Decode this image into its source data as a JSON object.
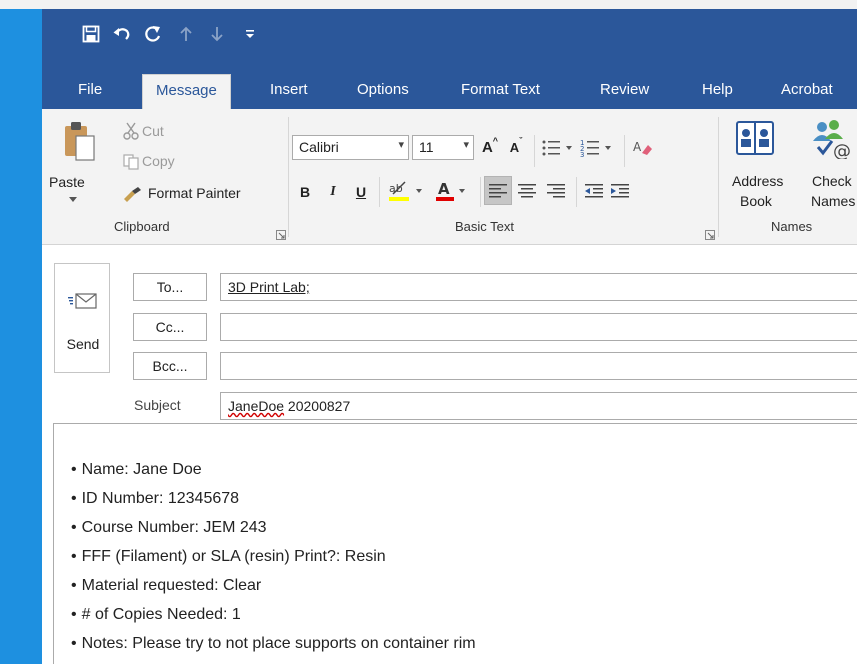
{
  "qat": {
    "icons": [
      "save-icon",
      "undo-icon",
      "redo-icon",
      "previous-item-icon",
      "next-item-icon",
      "customize-qat-icon"
    ]
  },
  "tabs": [
    {
      "label": "File",
      "active": false
    },
    {
      "label": "Message",
      "active": true
    },
    {
      "label": "Insert",
      "active": false
    },
    {
      "label": "Options",
      "active": false
    },
    {
      "label": "Format Text",
      "active": false
    },
    {
      "label": "Review",
      "active": false
    },
    {
      "label": "Help",
      "active": false
    },
    {
      "label": "Acrobat",
      "active": false
    }
  ],
  "ribbon": {
    "clipboard": {
      "label": "Clipboard",
      "paste": "Paste",
      "cut": "Cut",
      "copy": "Copy",
      "format_painter": "Format Painter"
    },
    "basic_text": {
      "label": "Basic Text",
      "font": "Calibri",
      "size": "11",
      "bold": "B",
      "italic": "I",
      "underline": "U"
    },
    "names": {
      "label": "Names",
      "address_book_line1": "Address",
      "address_book_line2": "Book",
      "check_names_line1": "Check",
      "check_names_line2": "Names"
    }
  },
  "compose": {
    "send": "Send",
    "to_button": "To...",
    "cc_button": "Cc...",
    "bcc_button": "Bcc...",
    "to_value": "3D Print Lab;",
    "cc_value": "",
    "bcc_value": "",
    "subject_label": "Subject",
    "subject_word1": "JaneDoe",
    "subject_word2": " 20200827"
  },
  "body_lines": [
    "Name: Jane Doe",
    "ID Number: 12345678",
    "Course Number: JEM 243",
    "FFF (Filament) or SLA (resin) Print?: Resin",
    "Material requested: Clear",
    "# of Copies Needed: 1",
    "Notes: Please try to not place supports on container rim"
  ],
  "colors": {
    "title_bar": "#2b579a",
    "accent": "#1e90e0",
    "ribbon_bg": "#f3f3f3"
  }
}
